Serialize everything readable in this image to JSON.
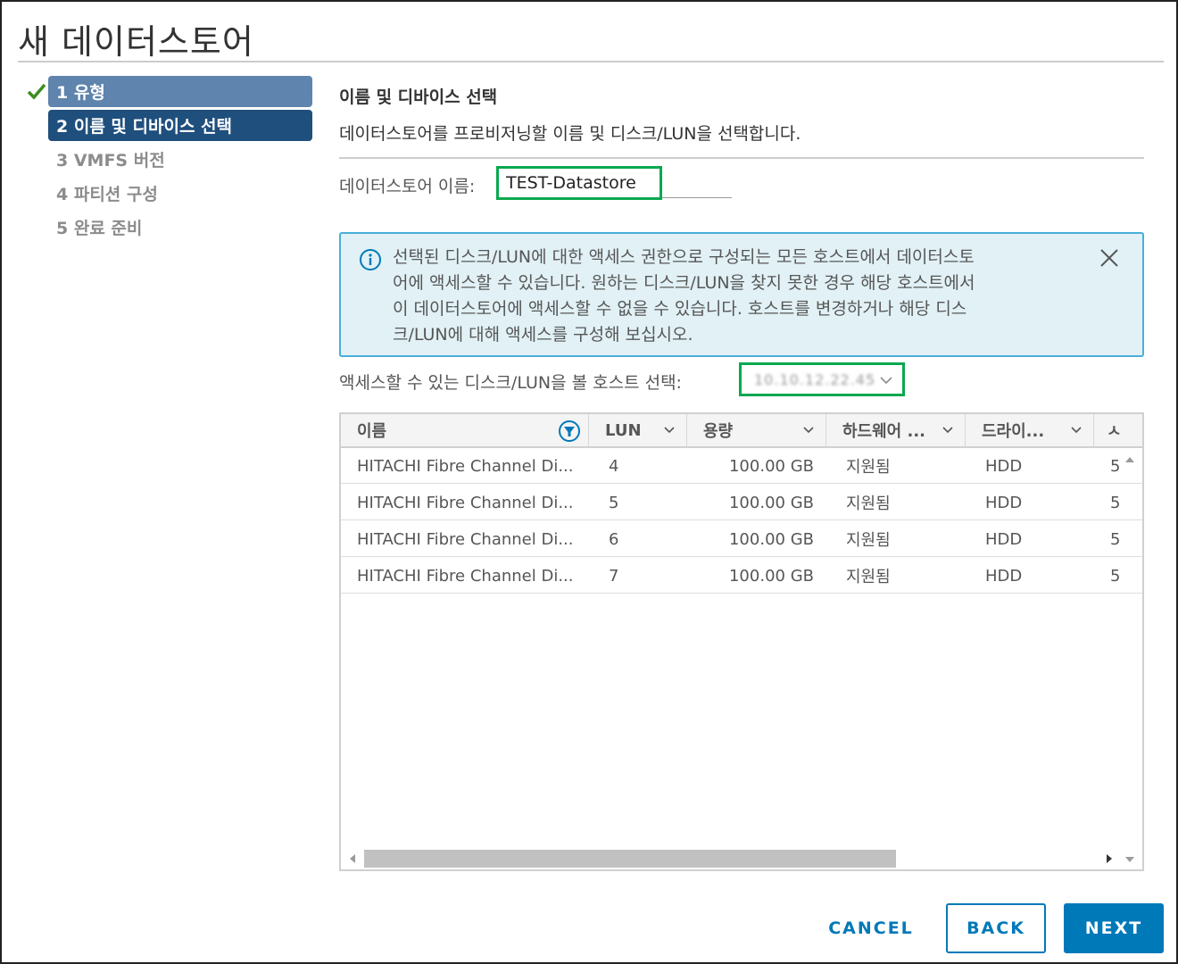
{
  "dialog": {
    "title": "새 데이터스토어"
  },
  "steps": [
    {
      "label": "1 유형",
      "state": "done"
    },
    {
      "label": "2 이름 및 디바이스 선택",
      "state": "active"
    },
    {
      "label": "3 VMFS 버전",
      "state": "pending"
    },
    {
      "label": "4 파티션 구성",
      "state": "pending"
    },
    {
      "label": "5 완료 준비",
      "state": "pending"
    }
  ],
  "section": {
    "title": "이름 및 디바이스 선택",
    "description": "데이터스토어를 프로비저닝할 이름 및 디스크/LUN을 선택합니다."
  },
  "name_field": {
    "label": "데이터스토어 이름:",
    "value": "TEST-Datastore"
  },
  "info": {
    "lines": [
      "선택된 디스크/LUN에 대한 액세스 권한으로 구성되는 모든 호스트에서 데이터스토",
      "어에 액세스할 수 있습니다. 원하는 디스크/LUN을 찾지 못한 경우 해당 호스트에서",
      "이 데이터스토어에 액세스할 수 없을 수 있습니다. 호스트를 변경하거나 해당 디스",
      "크/LUN에 대해 액세스를 구성해 보십시오."
    ],
    "icon": "info-circle-icon",
    "close_icon": "close-icon"
  },
  "host_field": {
    "label": "액세스할 수 있는 디스크/LUN을 볼 호스트 선택:",
    "value": "10.10.12.22.45"
  },
  "grid": {
    "columns": [
      "이름",
      "LUN",
      "용량",
      "하드웨어 ...",
      "드라이...",
      "ㅅ"
    ],
    "rows": [
      {
        "name": "HITACHI Fibre Channel Di...",
        "lun": "4",
        "capacity": "100.00 GB",
        "hw": "지원됨",
        "drive": "HDD",
        "extra": "5"
      },
      {
        "name": "HITACHI Fibre Channel Di...",
        "lun": "5",
        "capacity": "100.00 GB",
        "hw": "지원됨",
        "drive": "HDD",
        "extra": "5"
      },
      {
        "name": "HITACHI Fibre Channel Di...",
        "lun": "6",
        "capacity": "100.00 GB",
        "hw": "지원됨",
        "drive": "HDD",
        "extra": "5"
      },
      {
        "name": "HITACHI Fibre Channel Di...",
        "lun": "7",
        "capacity": "100.00 GB",
        "hw": "지원됨",
        "drive": "HDD",
        "extra": "5"
      }
    ]
  },
  "buttons": {
    "cancel": "CANCEL",
    "back": "BACK",
    "next": "NEXT"
  },
  "colors": {
    "primary": "#0079b8",
    "highlight_border": "#0aa84f",
    "step_done": "#5f84ad",
    "step_active": "#1f4f7d",
    "info_bg": "#e1f1f6",
    "info_border": "#49afd9"
  }
}
